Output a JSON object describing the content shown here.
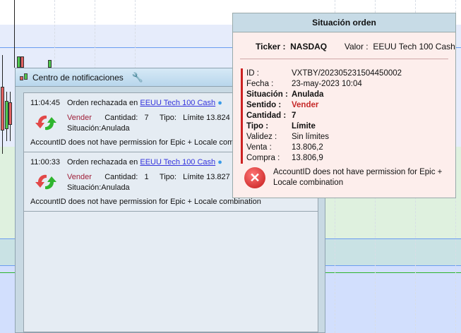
{
  "notifications": {
    "title": "Centro de notificaciones",
    "items": [
      {
        "time": "11:04:45",
        "message": "Orden rechazada en",
        "instrument": "EEUU Tech 100 Cash",
        "side": "Vender",
        "qty_label": "Cantidad:",
        "qty": "7",
        "type_label": "Tipo:",
        "type": "Límite 13.824",
        "status": "Situación:Anulada",
        "error": "AccountID does not have permission for Epic + Locale combination"
      },
      {
        "time": "11:00:33",
        "message": "Orden rechazada en",
        "instrument": "EEUU Tech 100 Cash",
        "side": "Vender",
        "qty_label": "Cantidad:",
        "qty": "1",
        "type_label": "Tipo:",
        "type": "Límite 13.827",
        "status": "Situación:Anulada",
        "error": "AccountID does not have permission for Epic + Locale combination"
      }
    ]
  },
  "detail": {
    "title": "Situación orden",
    "ticker_label": "Ticker :",
    "ticker": "NASDAQ",
    "valor_label": "Valor :",
    "valor": "EEUU Tech 100 Cash",
    "fields": [
      {
        "label": "ID :",
        "value": "VXTBY/202305231504450002",
        "bold": false
      },
      {
        "label": "Fecha :",
        "value": "23-may-2023 10:04",
        "bold": false
      },
      {
        "label": "Situación :",
        "value": "Anulada",
        "bold": true
      },
      {
        "label": "Sentido :",
        "value": "Vender",
        "bold": true,
        "color": "#c62828"
      },
      {
        "label": "Cantidad :",
        "value": "7",
        "bold": true
      },
      {
        "label": "Tipo :",
        "value": "Límite",
        "bold": true
      },
      {
        "label": "Validez :",
        "value": "Sin límites",
        "bold": false
      },
      {
        "label": "Venta :",
        "value": "13.806,2",
        "bold": false
      },
      {
        "label": "Compra :",
        "value": "13.806,9",
        "bold": false
      }
    ],
    "error": "AccountID does not have permission for Epic + Locale combination"
  }
}
